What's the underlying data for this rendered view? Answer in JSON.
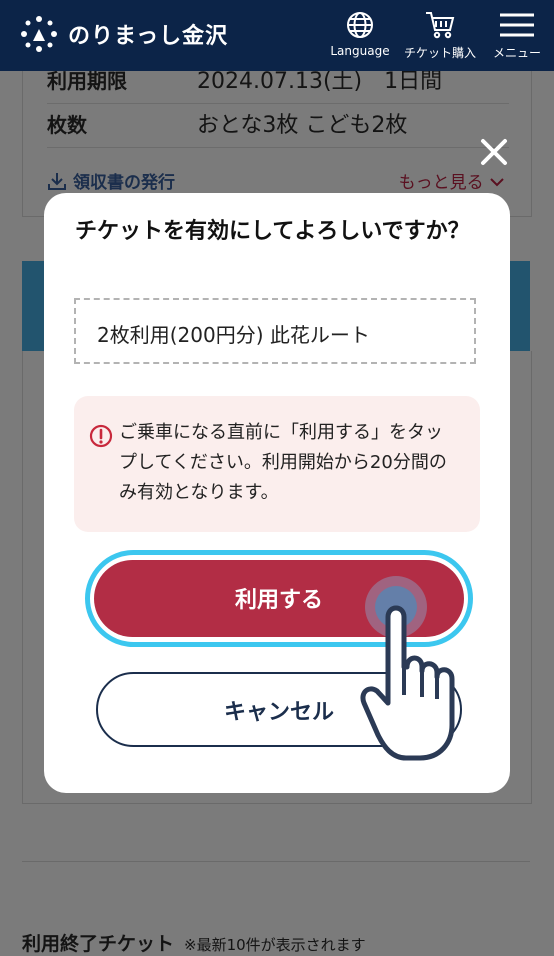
{
  "header": {
    "app_name": "のりまっし金沢",
    "language_label": "Language",
    "ticket_purchase_label": "チケット購入",
    "menu_label": "メニュー"
  },
  "ticket_card": {
    "expiry_label": "利用期限",
    "expiry_value": "2024.07.13(土)　1日間",
    "count_label": "枚数",
    "count_value": "おとな3枚 こども2枚",
    "receipt_label": "領収書の発行",
    "more_label": "もっと見る"
  },
  "used_section": {
    "title": "利用終了チケット",
    "note": "※最新10件が表示されます"
  },
  "modal": {
    "title": "チケットを有効にしてよろしいですか？",
    "route_text": "2枚利用(200円分) 此花ルート",
    "warning_text": "ご乗車になる直前に「利用する」をタップしてください。利用開始から20分間のみ有効となります。",
    "use_button": "利用する",
    "cancel_button": "キャンセル"
  },
  "colors": {
    "header_bg": "#0c2448",
    "primary_button": "#b22d45",
    "focus_ring": "#3cc7ef",
    "warning_bg": "#fbeeed",
    "warning_icon": "#c8283c",
    "navy": "#1b2e4c"
  },
  "icons": [
    "logo-emblem-icon",
    "globe-icon",
    "cart-icon",
    "hamburger-menu-icon",
    "download-icon",
    "chevron-down-icon",
    "close-icon",
    "alert-circle-icon",
    "pointing-hand-icon"
  ]
}
